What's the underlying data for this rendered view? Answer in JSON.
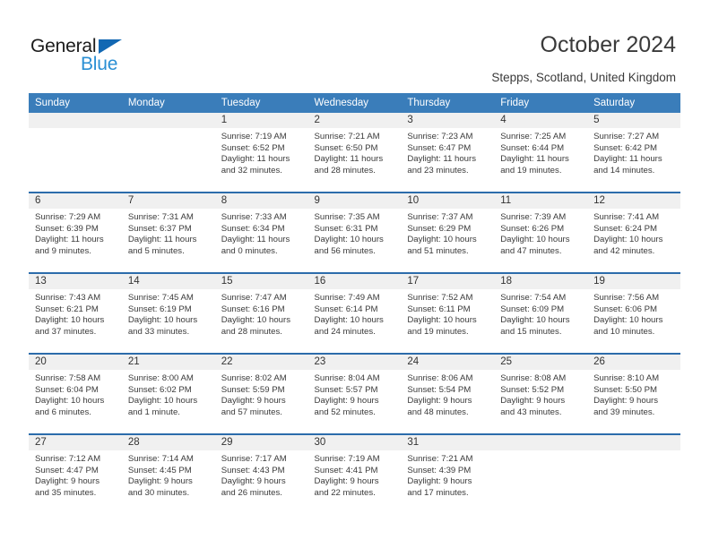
{
  "brand": {
    "word_one": "General",
    "word_two": "Blue",
    "triangle_color": "#1268b3",
    "blue_color": "#2a8fd4"
  },
  "header": {
    "title": "October 2024",
    "subtitle": "Stepps, Scotland, United Kingdom"
  },
  "theme": {
    "header_bar": "#3a7dba",
    "week_divider": "#2c6cab",
    "daynum_bar": "#f0f0f0"
  },
  "calendar": {
    "weekday_headers": [
      "Sunday",
      "Monday",
      "Tuesday",
      "Wednesday",
      "Thursday",
      "Friday",
      "Saturday"
    ],
    "labels": {
      "sunrise": "Sunrise:",
      "sunset": "Sunset:",
      "daylight": "Daylight:"
    },
    "weeks": [
      [
        {
          "day": "",
          "empty": true
        },
        {
          "day": "",
          "empty": true
        },
        {
          "day": "1",
          "sunrise": "Sunrise: 7:19 AM",
          "sunset": "Sunset: 6:52 PM",
          "daylight_1": "Daylight: 11 hours",
          "daylight_2": "and 32 minutes."
        },
        {
          "day": "2",
          "sunrise": "Sunrise: 7:21 AM",
          "sunset": "Sunset: 6:50 PM",
          "daylight_1": "Daylight: 11 hours",
          "daylight_2": "and 28 minutes."
        },
        {
          "day": "3",
          "sunrise": "Sunrise: 7:23 AM",
          "sunset": "Sunset: 6:47 PM",
          "daylight_1": "Daylight: 11 hours",
          "daylight_2": "and 23 minutes."
        },
        {
          "day": "4",
          "sunrise": "Sunrise: 7:25 AM",
          "sunset": "Sunset: 6:44 PM",
          "daylight_1": "Daylight: 11 hours",
          "daylight_2": "and 19 minutes."
        },
        {
          "day": "5",
          "sunrise": "Sunrise: 7:27 AM",
          "sunset": "Sunset: 6:42 PM",
          "daylight_1": "Daylight: 11 hours",
          "daylight_2": "and 14 minutes."
        }
      ],
      [
        {
          "day": "6",
          "sunrise": "Sunrise: 7:29 AM",
          "sunset": "Sunset: 6:39 PM",
          "daylight_1": "Daylight: 11 hours",
          "daylight_2": "and 9 minutes."
        },
        {
          "day": "7",
          "sunrise": "Sunrise: 7:31 AM",
          "sunset": "Sunset: 6:37 PM",
          "daylight_1": "Daylight: 11 hours",
          "daylight_2": "and 5 minutes."
        },
        {
          "day": "8",
          "sunrise": "Sunrise: 7:33 AM",
          "sunset": "Sunset: 6:34 PM",
          "daylight_1": "Daylight: 11 hours",
          "daylight_2": "and 0 minutes."
        },
        {
          "day": "9",
          "sunrise": "Sunrise: 7:35 AM",
          "sunset": "Sunset: 6:31 PM",
          "daylight_1": "Daylight: 10 hours",
          "daylight_2": "and 56 minutes."
        },
        {
          "day": "10",
          "sunrise": "Sunrise: 7:37 AM",
          "sunset": "Sunset: 6:29 PM",
          "daylight_1": "Daylight: 10 hours",
          "daylight_2": "and 51 minutes."
        },
        {
          "day": "11",
          "sunrise": "Sunrise: 7:39 AM",
          "sunset": "Sunset: 6:26 PM",
          "daylight_1": "Daylight: 10 hours",
          "daylight_2": "and 47 minutes."
        },
        {
          "day": "12",
          "sunrise": "Sunrise: 7:41 AM",
          "sunset": "Sunset: 6:24 PM",
          "daylight_1": "Daylight: 10 hours",
          "daylight_2": "and 42 minutes."
        }
      ],
      [
        {
          "day": "13",
          "sunrise": "Sunrise: 7:43 AM",
          "sunset": "Sunset: 6:21 PM",
          "daylight_1": "Daylight: 10 hours",
          "daylight_2": "and 37 minutes."
        },
        {
          "day": "14",
          "sunrise": "Sunrise: 7:45 AM",
          "sunset": "Sunset: 6:19 PM",
          "daylight_1": "Daylight: 10 hours",
          "daylight_2": "and 33 minutes."
        },
        {
          "day": "15",
          "sunrise": "Sunrise: 7:47 AM",
          "sunset": "Sunset: 6:16 PM",
          "daylight_1": "Daylight: 10 hours",
          "daylight_2": "and 28 minutes."
        },
        {
          "day": "16",
          "sunrise": "Sunrise: 7:49 AM",
          "sunset": "Sunset: 6:14 PM",
          "daylight_1": "Daylight: 10 hours",
          "daylight_2": "and 24 minutes."
        },
        {
          "day": "17",
          "sunrise": "Sunrise: 7:52 AM",
          "sunset": "Sunset: 6:11 PM",
          "daylight_1": "Daylight: 10 hours",
          "daylight_2": "and 19 minutes."
        },
        {
          "day": "18",
          "sunrise": "Sunrise: 7:54 AM",
          "sunset": "Sunset: 6:09 PM",
          "daylight_1": "Daylight: 10 hours",
          "daylight_2": "and 15 minutes."
        },
        {
          "day": "19",
          "sunrise": "Sunrise: 7:56 AM",
          "sunset": "Sunset: 6:06 PM",
          "daylight_1": "Daylight: 10 hours",
          "daylight_2": "and 10 minutes."
        }
      ],
      [
        {
          "day": "20",
          "sunrise": "Sunrise: 7:58 AM",
          "sunset": "Sunset: 6:04 PM",
          "daylight_1": "Daylight: 10 hours",
          "daylight_2": "and 6 minutes."
        },
        {
          "day": "21",
          "sunrise": "Sunrise: 8:00 AM",
          "sunset": "Sunset: 6:02 PM",
          "daylight_1": "Daylight: 10 hours",
          "daylight_2": "and 1 minute."
        },
        {
          "day": "22",
          "sunrise": "Sunrise: 8:02 AM",
          "sunset": "Sunset: 5:59 PM",
          "daylight_1": "Daylight: 9 hours",
          "daylight_2": "and 57 minutes."
        },
        {
          "day": "23",
          "sunrise": "Sunrise: 8:04 AM",
          "sunset": "Sunset: 5:57 PM",
          "daylight_1": "Daylight: 9 hours",
          "daylight_2": "and 52 minutes."
        },
        {
          "day": "24",
          "sunrise": "Sunrise: 8:06 AM",
          "sunset": "Sunset: 5:54 PM",
          "daylight_1": "Daylight: 9 hours",
          "daylight_2": "and 48 minutes."
        },
        {
          "day": "25",
          "sunrise": "Sunrise: 8:08 AM",
          "sunset": "Sunset: 5:52 PM",
          "daylight_1": "Daylight: 9 hours",
          "daylight_2": "and 43 minutes."
        },
        {
          "day": "26",
          "sunrise": "Sunrise: 8:10 AM",
          "sunset": "Sunset: 5:50 PM",
          "daylight_1": "Daylight: 9 hours",
          "daylight_2": "and 39 minutes."
        }
      ],
      [
        {
          "day": "27",
          "sunrise": "Sunrise: 7:12 AM",
          "sunset": "Sunset: 4:47 PM",
          "daylight_1": "Daylight: 9 hours",
          "daylight_2": "and 35 minutes."
        },
        {
          "day": "28",
          "sunrise": "Sunrise: 7:14 AM",
          "sunset": "Sunset: 4:45 PM",
          "daylight_1": "Daylight: 9 hours",
          "daylight_2": "and 30 minutes."
        },
        {
          "day": "29",
          "sunrise": "Sunrise: 7:17 AM",
          "sunset": "Sunset: 4:43 PM",
          "daylight_1": "Daylight: 9 hours",
          "daylight_2": "and 26 minutes."
        },
        {
          "day": "30",
          "sunrise": "Sunrise: 7:19 AM",
          "sunset": "Sunset: 4:41 PM",
          "daylight_1": "Daylight: 9 hours",
          "daylight_2": "and 22 minutes."
        },
        {
          "day": "31",
          "sunrise": "Sunrise: 7:21 AM",
          "sunset": "Sunset: 4:39 PM",
          "daylight_1": "Daylight: 9 hours",
          "daylight_2": "and 17 minutes."
        },
        {
          "day": "",
          "empty": true
        },
        {
          "day": "",
          "empty": true
        }
      ]
    ]
  }
}
